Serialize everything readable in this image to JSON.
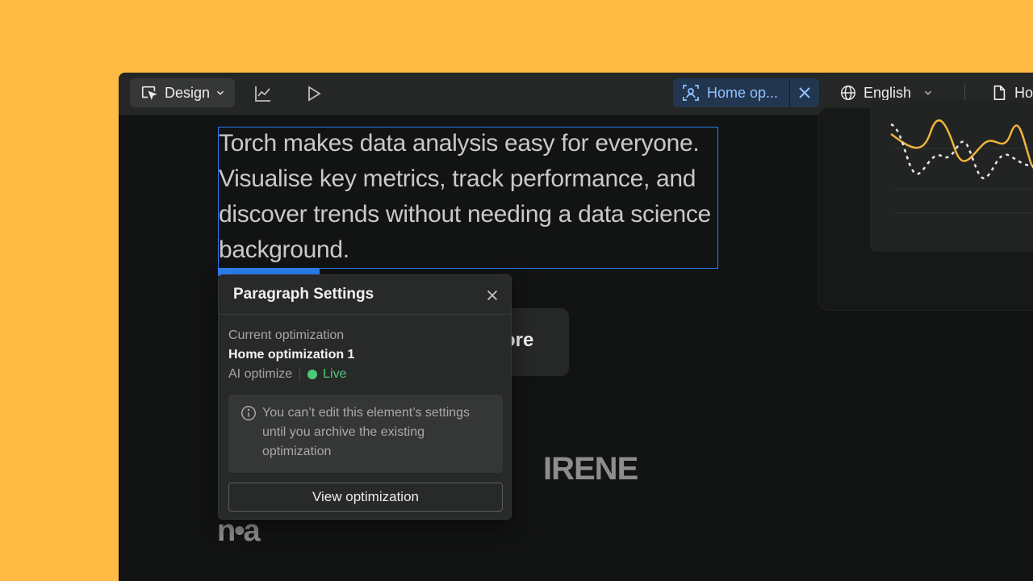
{
  "toolbar": {
    "mode_label": "Design",
    "mode_icon": "cursor-select-icon",
    "analytics_icon": "line-chart-icon",
    "preview_icon": "play-icon",
    "optimization_chip": {
      "label": "Home op...",
      "icon": "ai-person-icon",
      "close_icon": "close-icon"
    },
    "language": {
      "label": "English",
      "icon": "globe-icon"
    },
    "page": {
      "label": "Ho",
      "icon": "page-icon"
    }
  },
  "canvas": {
    "hero_text": "Torch makes data analysis easy for everyone. Visualise key metrics, track performance, and discover trends without needing a data science background.",
    "cta_label": "ore",
    "logos": [
      "IRENE",
      "n•a"
    ]
  },
  "panel": {
    "title": "Paragraph Settings",
    "current_label": "Current optimization",
    "current_name": "Home optimization 1",
    "type": "AI optimize",
    "status": "Live",
    "status_color": "#4ccb7c",
    "notice": "You can’t edit this element’s settings until you archive the existing optimization",
    "view_button": "View optimization"
  },
  "colors": {
    "background": "#ffbb44",
    "selection": "#2d7ff0",
    "chart_solid": "#f0b43c",
    "chart_dashed": "#e8e8e8"
  }
}
